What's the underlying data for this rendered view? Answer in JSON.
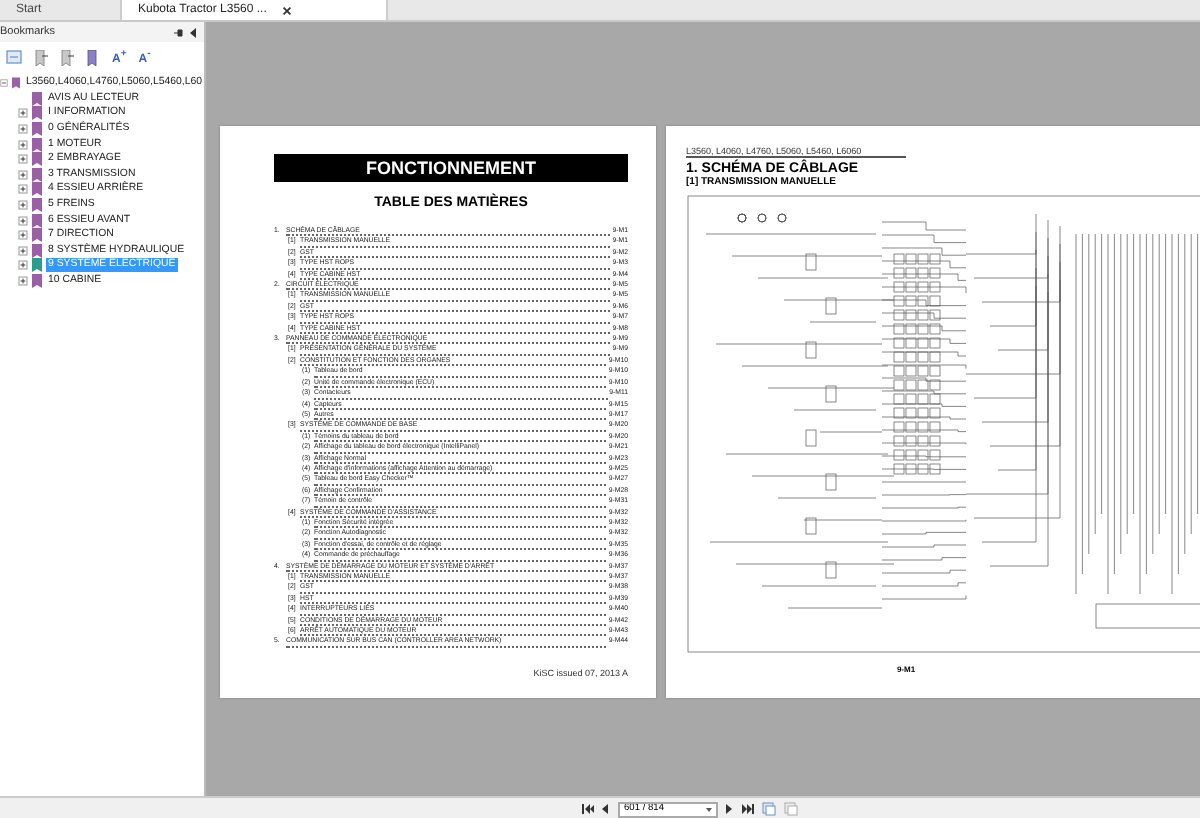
{
  "tabs": [
    {
      "label": "Start",
      "selected": false,
      "closable": false
    },
    {
      "label": "Kubota Tractor L3560 ...",
      "selected": true,
      "closable": true
    }
  ],
  "sidebar": {
    "title": "Bookmarks",
    "toolbar": [
      {
        "kind": "expand"
      },
      {
        "kind": "bookmark"
      },
      {
        "kind": "bookmark"
      },
      {
        "kind": "bookmark-color"
      },
      {
        "kind": "text",
        "label": "A$^{+}$"
      },
      {
        "kind": "text",
        "label": "A$^{-}$"
      }
    ],
    "tree": [
      {
        "label": "L3560,L4060,L4760,L5060,L5460,L60",
        "expanded": true,
        "selected": false,
        "children": [
          {
            "label": "AVIS AU LECTEUR",
            "selected": false
          },
          {
            "label": "I INFORMATION",
            "expanded": false,
            "selected": false,
            "has_children": true
          },
          {
            "label": "0 GÉNÉRALITÉS",
            "expanded": false,
            "selected": false,
            "has_children": true
          },
          {
            "label": "1 MOTEUR",
            "expanded": false,
            "selected": false,
            "has_children": true
          },
          {
            "label": "2 EMBRAYAGE",
            "expanded": false,
            "selected": false,
            "has_children": true
          },
          {
            "label": "3 TRANSMISSION",
            "expanded": false,
            "selected": false,
            "has_children": true
          },
          {
            "label": "4 ESSIEU ARRIÈRE",
            "expanded": false,
            "selected": false,
            "has_children": true
          },
          {
            "label": "5 FREINS",
            "expanded": false,
            "selected": false,
            "has_children": true
          },
          {
            "label": "6 ESSIEU AVANT",
            "expanded": false,
            "selected": false,
            "has_children": true
          },
          {
            "label": "7 DIRECTION",
            "expanded": false,
            "selected": false,
            "has_children": true
          },
          {
            "label": "8 SYSTÈME HYDRAULIQUE",
            "expanded": false,
            "selected": false,
            "has_children": true
          },
          {
            "label": "9 SYSTÈME ÉLECTRIQUE",
            "expanded": false,
            "selected": true,
            "has_children": true
          },
          {
            "label": "10 CABINE",
            "expanded": false,
            "selected": false,
            "has_children": true
          }
        ]
      }
    ]
  },
  "left_page": {
    "banner": "FONCTIONNEMENT",
    "heading": "TABLE DES MATIÈRES",
    "footer": "KiSC issued 07, 2013 A",
    "toc": [
      {
        "num": "1.",
        "title": "SCHÉMA DE CÂBLAGE",
        "page": "9-M1",
        "children": [
          {
            "num": "[1]",
            "title": "TRANSMISSION MANUELLE",
            "page": "9-M1"
          },
          {
            "num": "[2]",
            "title": "GST",
            "page": "9-M2"
          },
          {
            "num": "[3]",
            "title": "TYPE HST ROPS",
            "page": "9-M3"
          },
          {
            "num": "[4]",
            "title": "TYPE CABINE HST",
            "page": "9-M4"
          }
        ]
      },
      {
        "num": "2.",
        "title": "CIRCUIT ÉLECTRIQUE",
        "page": "9-M5",
        "children": [
          {
            "num": "[1]",
            "title": "TRANSMISSION MANUELLE",
            "page": "9-M5"
          },
          {
            "num": "[2]",
            "title": "GST",
            "page": "9-M6"
          },
          {
            "num": "[3]",
            "title": "TYPE HST ROPS",
            "page": "9-M7"
          },
          {
            "num": "[4]",
            "title": "TYPE CABINE HST",
            "page": "9-M8"
          }
        ]
      },
      {
        "num": "3.",
        "title": "PANNEAU DE COMMANDE ÉLECTRONIQUE",
        "page": "9-M9",
        "children": [
          {
            "num": "[1]",
            "title": "PRÉSENTATION GÉNÉRALE DU SYSTÈME",
            "page": "9-M9"
          },
          {
            "num": "[2]",
            "title": "CONSTITUTION ET FONCTION DES ORGANES",
            "page": "9-M10",
            "children": [
              {
                "num": "(1)",
                "title": "Tableau de bord",
                "page": "9-M10"
              },
              {
                "num": "(2)",
                "title": "Unité de commande électronique (ECU)",
                "page": "9-M10"
              },
              {
                "num": "(3)",
                "title": "Contacteurs",
                "page": "9-M11"
              },
              {
                "num": "(4)",
                "title": "Capteurs",
                "page": "9-M15"
              },
              {
                "num": "(5)",
                "title": "Autres",
                "page": "9-M17"
              }
            ]
          },
          {
            "num": "[3]",
            "title": "SYSTÈME DE COMMANDE DE BASE",
            "page": "9-M20",
            "children": [
              {
                "num": "(1)",
                "title": "Témoins du tableau de bord",
                "page": "9-M20"
              },
              {
                "num": "(2)",
                "title": "Affichage du tableau de bord électronique (IntelliPanel)",
                "page": "9-M21"
              },
              {
                "num": "(3)",
                "title": "Affichage Normal",
                "page": "9-M23"
              },
              {
                "num": "(4)",
                "title": "Affichage d'informations (affichage Attention au démarrage)",
                "page": "9-M25"
              },
              {
                "num": "(5)",
                "title": "Tableau de bord Easy Checker™",
                "page": "9-M27"
              },
              {
                "num": "(6)",
                "title": "Affichage Confirmation",
                "page": "9-M28"
              },
              {
                "num": "(7)",
                "title": "Témoin de contrôle",
                "page": "9-M31"
              }
            ]
          },
          {
            "num": "[4]",
            "title": "SYSTÈME DE COMMANDE D'ASSISTANCE",
            "page": "9-M32",
            "children": [
              {
                "num": "(1)",
                "title": "Fonction Sécurité intégrée",
                "page": "9-M32"
              },
              {
                "num": "(2)",
                "title": "Fonction Autodiagnostic",
                "page": "9-M32"
              },
              {
                "num": "(3)",
                "title": "Fonction d'essai, de contrôle et de réglage",
                "page": "9-M35"
              },
              {
                "num": "(4)",
                "title": "Commande de préchauffage",
                "page": "9-M36"
              }
            ]
          }
        ]
      },
      {
        "num": "4.",
        "title": "SYSTÈME DE DÉMARRAGE DU MOTEUR ET SYSTÈME D'ARRÊT",
        "page": "9-M37",
        "children": [
          {
            "num": "[1]",
            "title": "TRANSMISSION MANUELLE",
            "page": "9-M37"
          },
          {
            "num": "[2]",
            "title": "GST",
            "page": "9-M38"
          },
          {
            "num": "[3]",
            "title": "HST",
            "page": "9-M39"
          },
          {
            "num": "[4]",
            "title": "INTERRUPTEURS LIÉS",
            "page": "9-M40"
          },
          {
            "num": "[5]",
            "title": "CONDITIONS DE DÉMARRAGE DU MOTEUR",
            "page": "9-M42"
          },
          {
            "num": "[6]",
            "title": "ARRÊT AUTOMATIQUE DU MOTEUR",
            "page": "9-M43"
          }
        ]
      },
      {
        "num": "5.",
        "title": "COMMUNICATION SUR BUS CAN (CONTROLLER AREA NETWORK)",
        "page": "9-M44"
      }
    ]
  },
  "right_page": {
    "header": "L3560, L4060, L4760, L5060, L5460, L6060",
    "heading": "1.  SCHÉMA DE CÂBLAGE",
    "subheading": "[1]  TRANSMISSION MANUELLE",
    "page_number": "9-M1"
  },
  "status_bar": {
    "page_field": "601 / 814"
  }
}
